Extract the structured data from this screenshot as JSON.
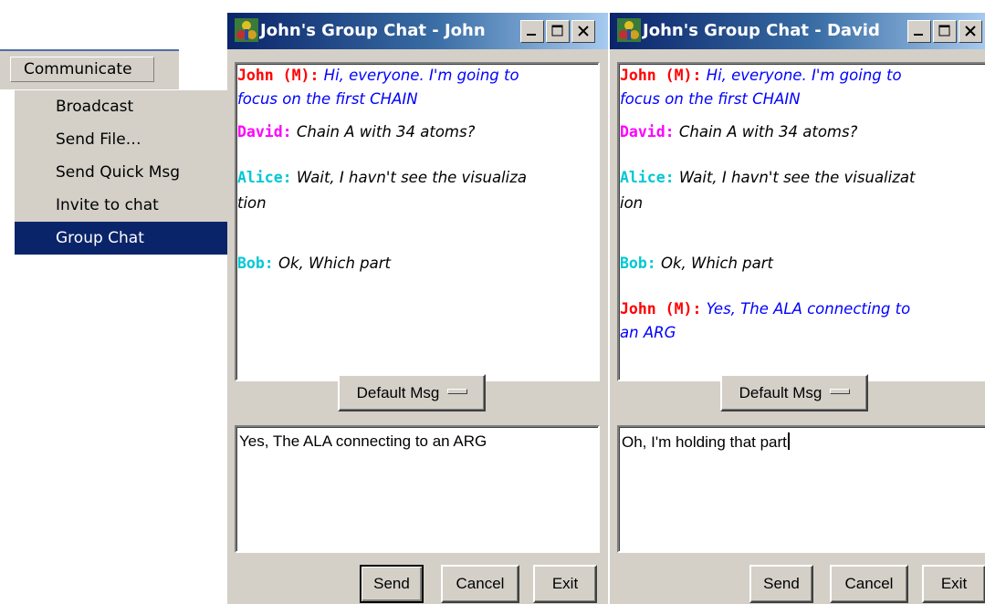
{
  "menu": {
    "title": "Communicate",
    "items": [
      {
        "label": "Broadcast",
        "selected": false
      },
      {
        "label": "Send File…",
        "selected": false
      },
      {
        "label": "Send Quick Msg",
        "selected": false
      },
      {
        "label": "Invite to chat",
        "selected": false
      },
      {
        "label": "Group Chat",
        "selected": true
      }
    ]
  },
  "colors": {
    "selection": "#0a246a",
    "john": "#ff0000",
    "john_text": "#0000ff",
    "david": "#ff00ff",
    "alice": "#00c8d4",
    "bob": "#00c8d4",
    "other_text": "#000000"
  },
  "windows": [
    {
      "title": "John's Group Chat - John",
      "messages": [
        {
          "who": "John (M):",
          "lines": [
            "Hi, everyone. I'm going to",
            "focus on the first CHAIN"
          ]
        },
        {
          "who": "David:",
          "lines": [
            "Chain A with 34 atoms?"
          ]
        },
        {
          "who": "Alice:",
          "lines": [
            "Wait, I havn't see the visualiza",
            "tion"
          ]
        },
        {
          "who": "Bob:",
          "lines": [
            "Ok, Which part"
          ]
        }
      ],
      "default_msg_label": "Default Msg",
      "input_value": "Yes, The ALA connecting to an ARG",
      "send_label": "Send",
      "cancel_label": "Cancel",
      "exit_label": "Exit"
    },
    {
      "title": "John's Group Chat - David",
      "messages": [
        {
          "who": "John (M):",
          "lines": [
            "Hi, everyone. I'm going to",
            "focus on the first CHAIN"
          ]
        },
        {
          "who": "David:",
          "lines": [
            "Chain A with 34 atoms?"
          ]
        },
        {
          "who": "Alice:",
          "lines": [
            "Wait, I havn't see the visualizat",
            "ion"
          ]
        },
        {
          "who": "Bob:",
          "lines": [
            "Ok, Which part"
          ]
        },
        {
          "who": "John (M):",
          "lines": [
            "Yes, The ALA connecting to",
            "an ARG"
          ]
        }
      ],
      "default_msg_label": "Default Msg",
      "input_value": "Oh, I'm holding that part",
      "send_label": "Send",
      "cancel_label": "Cancel",
      "exit_label": "Exit"
    }
  ]
}
